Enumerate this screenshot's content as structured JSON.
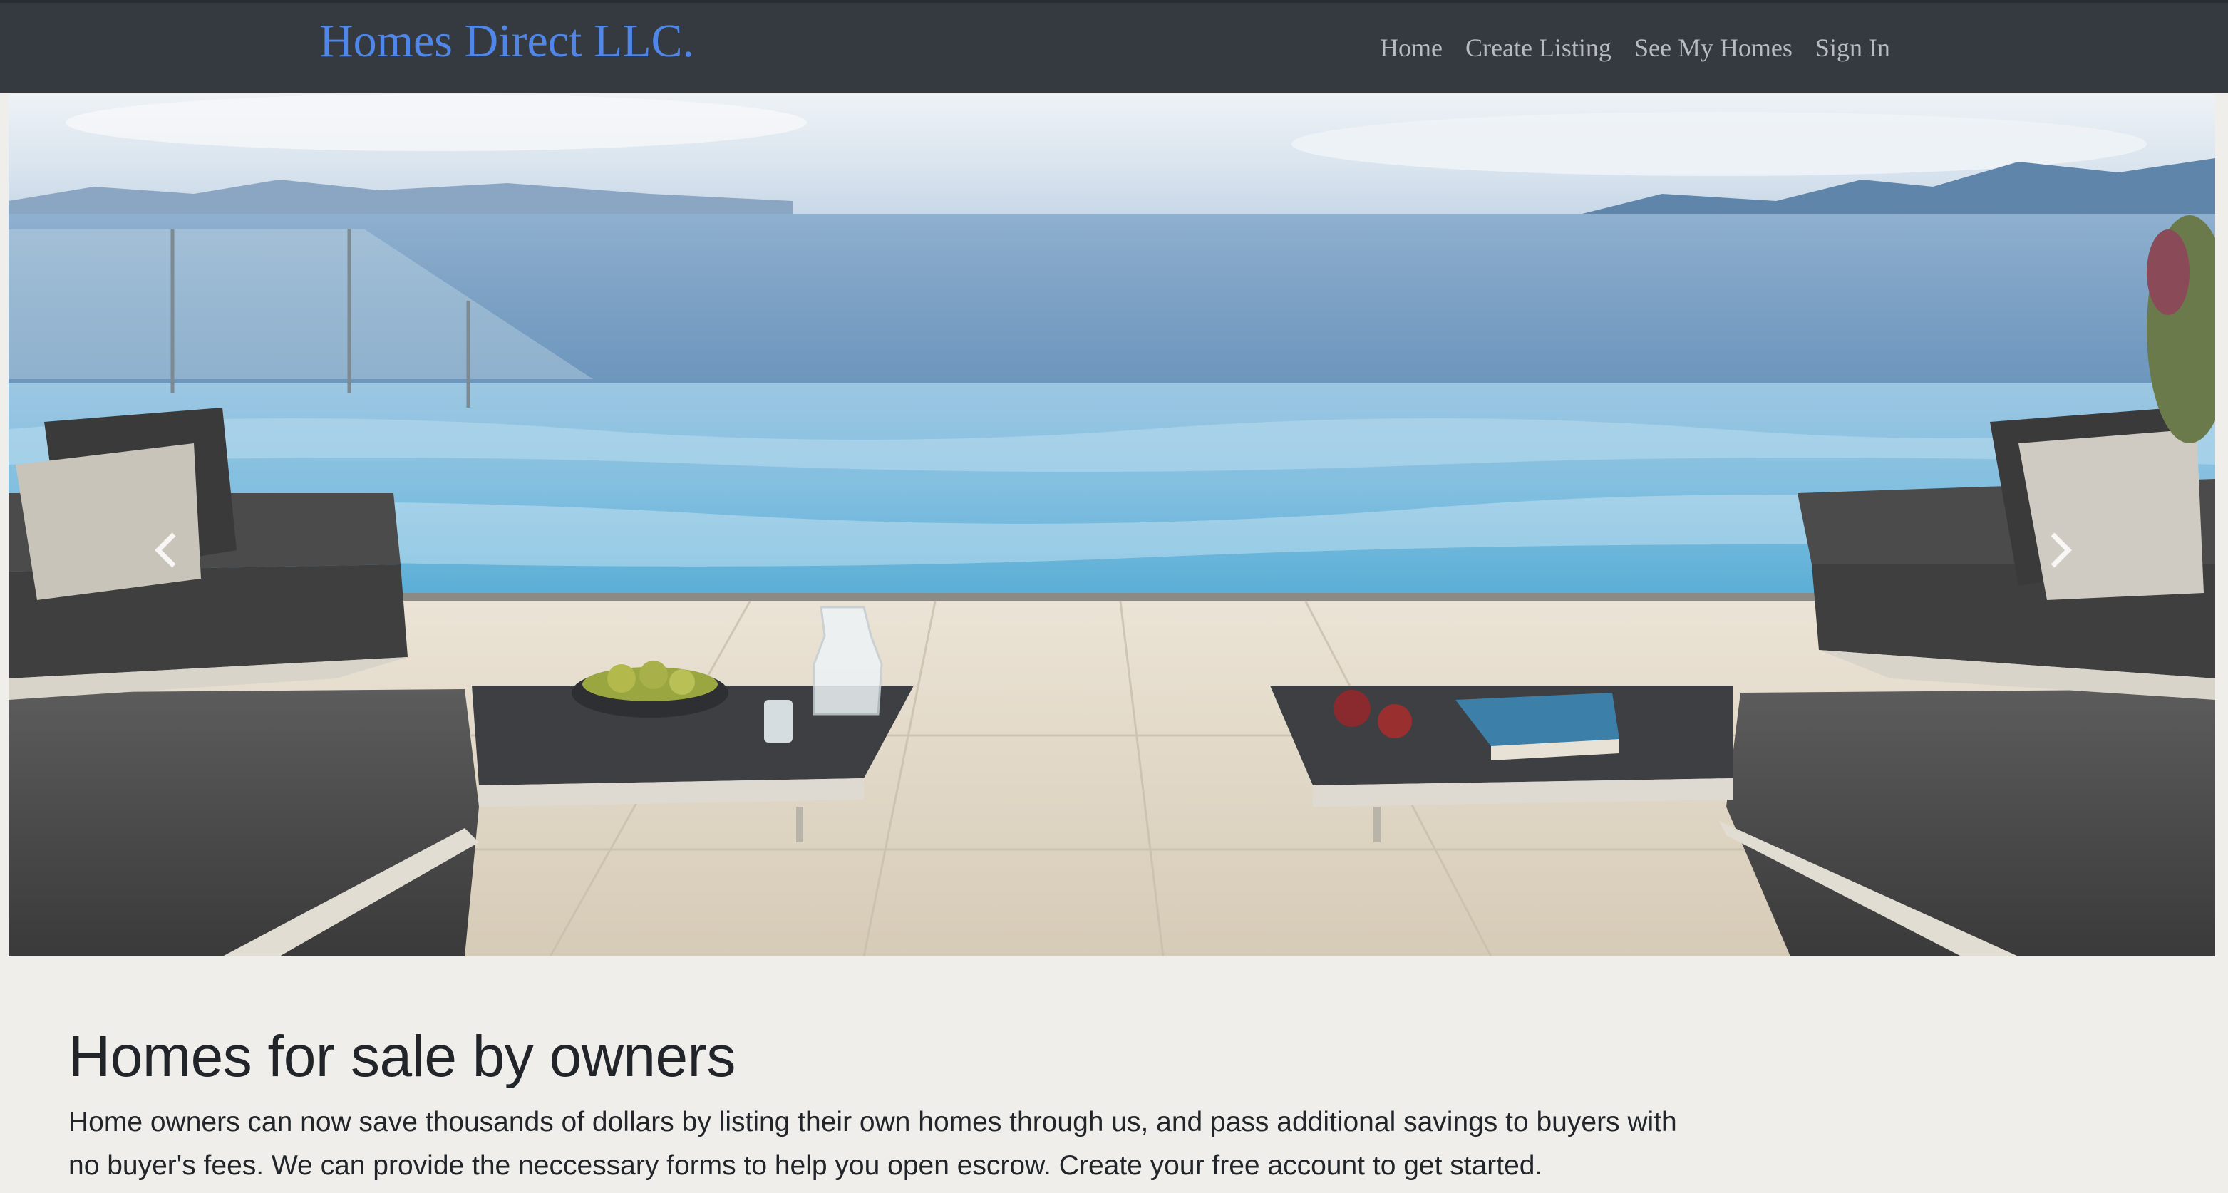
{
  "brand": {
    "title": "Homes Direct LLC."
  },
  "nav": {
    "items": [
      {
        "label": "Home"
      },
      {
        "label": "Create Listing"
      },
      {
        "label": "See My Homes"
      },
      {
        "label": "Sign In"
      }
    ]
  },
  "carousel": {
    "slide_count": 3,
    "active_slide": 1,
    "prev_icon": "chevron-left-icon",
    "next_icon": "chevron-right-icon"
  },
  "intro": {
    "heading": "Homes for sale by owners",
    "body": "Home owners can now save thousands of dollars by listing their own homes through us, and pass additional savings to buyers with no buyer's fees. We can provide the neccessary forms to help you open escrow. Create your free account to get started."
  },
  "colors": {
    "navbar": "#343a40",
    "brand": "#4f86e8",
    "nav_link": "#b8bcc0",
    "page_background": "#efeeea"
  }
}
